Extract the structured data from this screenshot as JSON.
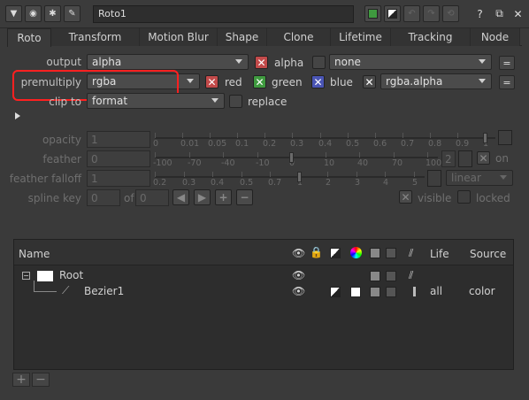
{
  "title_bar": {
    "node_name": "Roto1",
    "buttons": [
      "?",
      "⧉",
      "✕"
    ]
  },
  "tabs": [
    "Roto",
    "Transform",
    "Motion Blur",
    "Shape",
    "Clone",
    "Lifetime",
    "Tracking",
    "Node"
  ],
  "active_tab": "Roto",
  "output": {
    "label": "output",
    "value": "alpha",
    "checkbox_label": "alpha",
    "second_value": "none"
  },
  "premultiply": {
    "label": "premultiply",
    "value": "rgba",
    "red_label": "red",
    "green_label": "green",
    "blue_label": "blue",
    "mask_value": "rgba.alpha"
  },
  "clip_to": {
    "label": "clip to",
    "value": "format",
    "replace_label": "replace"
  },
  "opacity": {
    "label": "opacity",
    "value": "1",
    "ticks": [
      "0",
      "0.01",
      "0.05",
      "0.1",
      "0.2",
      "0.3",
      "0.4",
      "0.5",
      "0.6",
      "0.7",
      "0.8",
      "0.9",
      "1"
    ]
  },
  "feather": {
    "label": "feather",
    "value": "0",
    "ticks": [
      "-100",
      "-70",
      "-40",
      "-10",
      "0",
      "10",
      "40",
      "70",
      "100"
    ],
    "count": "2",
    "on_label": "on"
  },
  "feather_falloff": {
    "label": "feather falloff",
    "value": "1",
    "ticks": [
      "0.2",
      "0.3",
      "0.4",
      "0.5",
      "0.7",
      "1",
      "2",
      "3",
      "4",
      "5"
    ],
    "mode": "linear"
  },
  "spline_key": {
    "label": "spline key",
    "value": "0",
    "of_label": "of",
    "total": "0",
    "visible_label": "visible",
    "locked_label": "locked"
  },
  "table": {
    "headers": {
      "name": "Name",
      "life": "Life",
      "source": "Source"
    },
    "rows": [
      {
        "name": "Root",
        "life": "",
        "source": ""
      },
      {
        "name": "Bezier1",
        "life": "all",
        "source": "color"
      }
    ]
  },
  "colors": {
    "red_check": "#c24a4a",
    "green_check": "#3f9a3f",
    "blue_check": "#4a55b5",
    "highlight": "#ff2020"
  }
}
